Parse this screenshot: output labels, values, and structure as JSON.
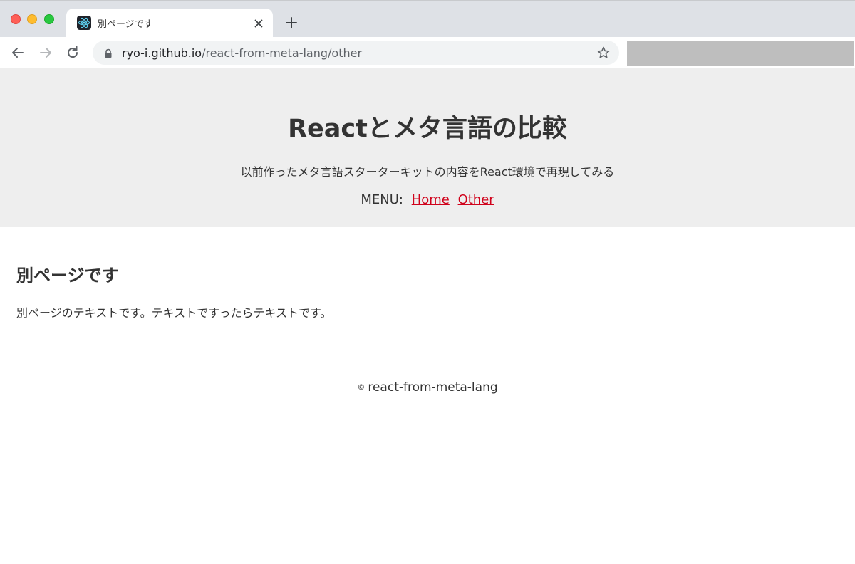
{
  "browser": {
    "tab": {
      "title": "別ページです"
    },
    "address_bar": {
      "host": "ryo-i.github.io",
      "path": "/react-from-meta-lang/other"
    }
  },
  "site": {
    "title": "Reactとメタ言語の比較",
    "description": "以前作ったメタ言語スターターキットの内容をReact環境で再現してみる",
    "menu": {
      "label": "MENU:",
      "items": [
        {
          "label": "Home"
        },
        {
          "label": "Other"
        }
      ]
    }
  },
  "content": {
    "heading": "別ページです",
    "text": "別ページのテキストです。テキストですったらテキストです。"
  },
  "footer": {
    "symbol": "©",
    "text": "react-from-meta-lang"
  },
  "colors": {
    "link": "#d0021b",
    "header_bg": "#eeeeee",
    "text": "#333333"
  },
  "icons": {
    "favicon": "react-logo-icon",
    "close": "close-icon",
    "new_tab": "plus-icon",
    "back": "arrow-left-icon",
    "forward": "arrow-right-icon",
    "reload": "reload-icon",
    "lock": "lock-icon",
    "bookmark": "star-icon"
  }
}
